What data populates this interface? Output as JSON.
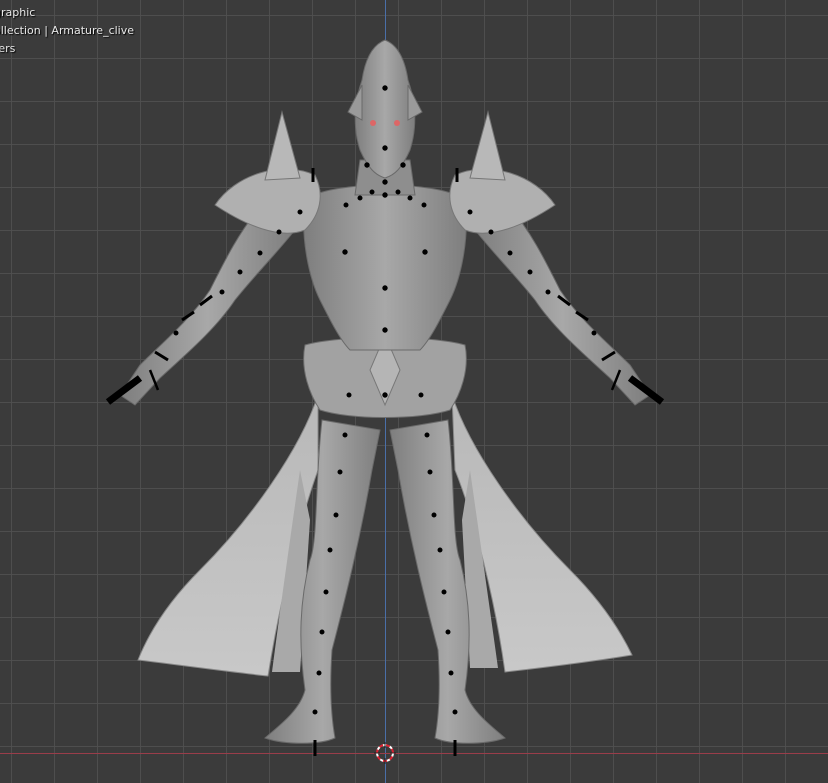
{
  "viewport": {
    "view_name": "graphic",
    "collection_line": "ollection | Armature_clive",
    "third_line": "ters"
  },
  "colors": {
    "background": "#3b3b3b",
    "grid": "#505050",
    "z_axis": "#4a6fa8",
    "x_axis": "#9a3d4a",
    "model": "#9c9c9c",
    "bones": "#000000"
  },
  "icons": [
    "3d-cursor-icon"
  ]
}
